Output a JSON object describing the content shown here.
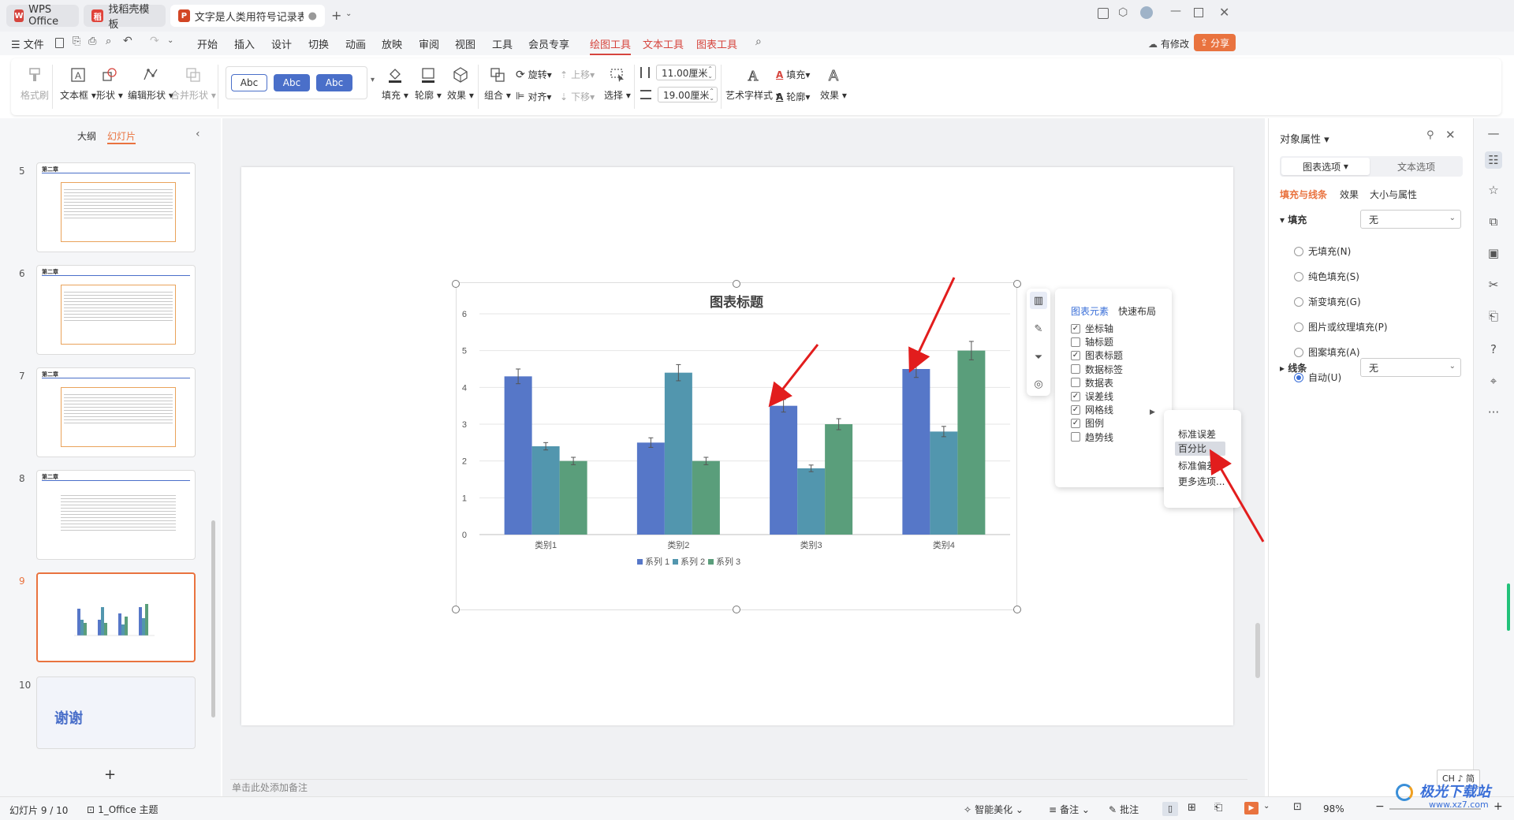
{
  "tabs": [
    {
      "label": "WPS Office"
    },
    {
      "label": "找稻壳模板"
    },
    {
      "label": "文字是人类用符号记录表达信息以"
    }
  ],
  "menu": {
    "file": "文件",
    "items": [
      "开始",
      "插入",
      "设计",
      "切换",
      "动画",
      "放映",
      "审阅",
      "视图",
      "工具",
      "会员专享"
    ],
    "context": [
      "绘图工具",
      "文本工具",
      "图表工具"
    ],
    "modified": "有修改",
    "share": "分享"
  },
  "ribbon": {
    "format_painter": "格式刷",
    "textbox": "文本框",
    "shape": "形状",
    "edit_shape": "编辑形状",
    "merge_shape": "合并形状",
    "style_sample": "Abc",
    "fill": "填充",
    "outline": "轮廓",
    "effect": "效果",
    "group": "组合",
    "rotate": "旋转",
    "align": "对齐",
    "bring_up": "上移",
    "send_down": "下移",
    "select": "选择",
    "width": "11.00厘米",
    "height": "19.00厘米",
    "art_text": "艺术字样式",
    "text_fill": "填充",
    "text_outline": "轮廓",
    "text_effect": "效果"
  },
  "left_pane": {
    "outline_tab": "大纲",
    "slides_tab": "幻灯片",
    "slides": [
      {
        "num": "5",
        "heading": "第二章"
      },
      {
        "num": "6",
        "heading": "第二章"
      },
      {
        "num": "7",
        "heading": "第二章"
      },
      {
        "num": "8",
        "heading": "第二章"
      },
      {
        "num": "9",
        "heading": ""
      },
      {
        "num": "10",
        "heading": "谢谢"
      }
    ],
    "add": "+"
  },
  "notes_placeholder": "单击此处添加备注",
  "chart_data": {
    "type": "bar",
    "title": "图表标题",
    "categories": [
      "类别1",
      "类别2",
      "类别3",
      "类别4"
    ],
    "series": [
      {
        "name": "系列 1",
        "values": [
          4.3,
          2.5,
          3.5,
          4.5
        ],
        "errors": [
          0.2,
          0.13,
          0.17,
          0.23
        ],
        "color": "#5677c8"
      },
      {
        "name": "系列 2",
        "values": [
          2.4,
          4.4,
          1.8,
          2.8
        ],
        "errors": [
          0.1,
          0.22,
          0.09,
          0.14
        ],
        "color": "#5296ae"
      },
      {
        "name": "系列 3",
        "values": [
          2.0,
          2.0,
          3.0,
          5.0
        ],
        "errors": [
          0.1,
          0.1,
          0.15,
          0.25
        ],
        "color": "#5a9e7b"
      }
    ],
    "ylim": [
      0,
      6
    ],
    "yticks": [
      "0",
      "1",
      "2",
      "3",
      "4",
      "5",
      "6"
    ],
    "grid": true,
    "legend": "bottom"
  },
  "chart_popup": {
    "tab_elements": "图表元素",
    "tab_layout": "快速布局",
    "items": [
      {
        "label": "坐标轴",
        "checked": true
      },
      {
        "label": "轴标题",
        "checked": false
      },
      {
        "label": "图表标题",
        "checked": true
      },
      {
        "label": "数据标签",
        "checked": false
      },
      {
        "label": "数据表",
        "checked": false
      },
      {
        "label": "误差线",
        "checked": true
      },
      {
        "label": "网格线",
        "checked": true
      },
      {
        "label": "图例",
        "checked": true
      },
      {
        "label": "趋势线",
        "checked": false
      }
    ],
    "submenu": [
      "标准误差",
      "百分比",
      "标准偏差",
      "更多选项..."
    ]
  },
  "right_pane": {
    "title": "对象属性",
    "tab_chart": "图表选项",
    "tab_text": "文本选项",
    "sub_fill_line": "填充与线条",
    "sub_effect": "效果",
    "sub_size": "大小与属性",
    "fill_label": "填充",
    "fill_value": "无",
    "fill_options": [
      {
        "label": "无填充(N)",
        "on": false
      },
      {
        "label": "纯色填充(S)",
        "on": false
      },
      {
        "label": "渐变填充(G)",
        "on": false
      },
      {
        "label": "图片或纹理填充(P)",
        "on": false
      },
      {
        "label": "图案填充(A)",
        "on": false
      },
      {
        "label": "自动(U)",
        "on": true
      }
    ],
    "line_label": "线条",
    "line_value": "无"
  },
  "status": {
    "slide": "幻灯片 9 / 10",
    "theme": "1_Office 主题",
    "beautify": "智能美化",
    "notes": "备注",
    "comments": "批注",
    "zoom": "98%",
    "ime": "CH ♪ 简"
  },
  "watermark": "极光下载站",
  "watermark_url": "www.xz7.com",
  "colors": {
    "accent": "#d6453e",
    "selection": "#e9733f",
    "blue": "#3a6fd8"
  }
}
